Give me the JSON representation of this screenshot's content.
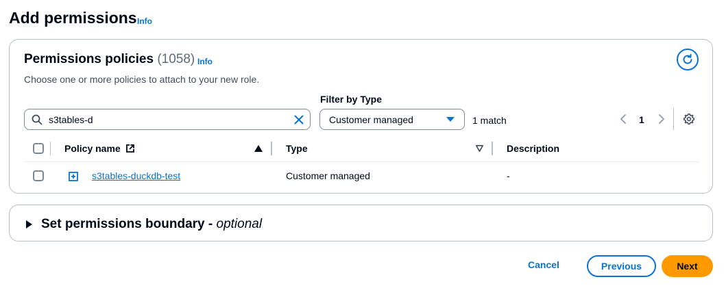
{
  "page": {
    "title": "Add permissions",
    "info_label": "Info"
  },
  "policies": {
    "title": "Permissions policies",
    "count": "(1058)",
    "info_label": "Info",
    "description": "Choose one or more policies to attach to your new role.",
    "filter_label": "Filter by Type",
    "search_value": "s3tables-d",
    "type_filter_value": "Customer managed",
    "match_text": "1 match",
    "current_page": "1",
    "columns": {
      "policy_name": "Policy name",
      "type": "Type",
      "description": "Description"
    },
    "rows": [
      {
        "policy_name": "s3tables-duckdb-test",
        "type": "Customer managed",
        "description": "-"
      }
    ]
  },
  "boundary": {
    "title": "Set permissions boundary - ",
    "optional": "optional"
  },
  "actions": {
    "cancel": "Cancel",
    "previous": "Previous",
    "next": "Next"
  },
  "colors": {
    "link_blue": "#0972d3",
    "primary_orange": "#ff9900",
    "text_dark": "#000716",
    "border_gray": "#b6bec9"
  },
  "icons": {
    "refresh": "refresh-icon",
    "search": "search-icon",
    "clear": "close-icon",
    "caret": "caret-down-icon",
    "prev": "chevron-left-icon",
    "next": "chevron-right-icon",
    "settings": "gear-icon",
    "external": "external-link-icon",
    "sort_asc": "sort-ascending-icon",
    "sort_desc": "sort-descending-icon",
    "expand": "expand-plus-icon",
    "boundary_caret": "caret-right-icon"
  }
}
